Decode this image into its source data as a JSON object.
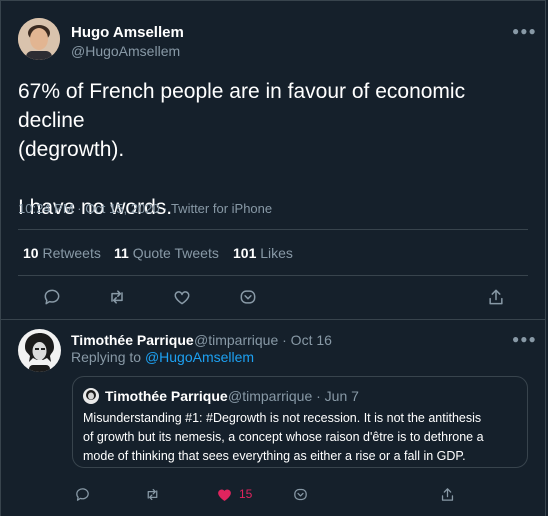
{
  "tweet": {
    "author_name": "Hugo Amsellem",
    "author_handle": "@HugoAmsellem",
    "line1": "67% of French people are in favour of economic decline",
    "line2": "(degrowth).",
    "line3": "I have no words.",
    "meta": "10:24 PM · Oct 15, 2020 · Twitter for iPhone",
    "retweets_count": "10",
    "retweets_label": "Retweets",
    "quotes_count": "11",
    "quotes_label": "Quote Tweets",
    "likes_count": "101",
    "likes_label": "Likes"
  },
  "reply": {
    "author_name": "Timothée Parrique",
    "author_meta": "@timparrique · Oct 16",
    "replying_prefix": "Replying to",
    "replying_handle": "@HugoAmsellem",
    "like_count": "15",
    "quoted": {
      "author_name": "Timothée Parrique",
      "author_meta": "@timparrique · Jun 7",
      "line1": "Misunderstanding #1: #Degrowth is not recession. It is not the antithesis",
      "line2": "of growth but its nemesis, a concept whose raison d'être is to dethrone a",
      "line3": "mode of thinking that sees everything as either a rise or a fall in GDP."
    }
  },
  "colors": {
    "background": "#15202b",
    "border": "#38444d",
    "muted_text": "#8899a6",
    "link": "#1da1f2",
    "liked": "#e0245e"
  },
  "icons": [
    "more-icon",
    "reply-icon",
    "retweet-icon",
    "like-icon",
    "bookmark-icon",
    "share-icon"
  ]
}
